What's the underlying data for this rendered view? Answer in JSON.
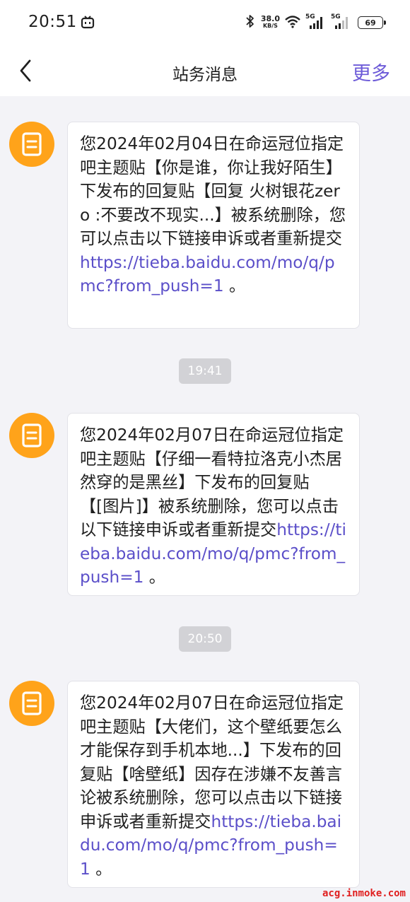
{
  "status_bar": {
    "time": "20:51",
    "net_speed_value": "38.0",
    "net_speed_unit": "KB/S",
    "sim1_label": "5G",
    "sim2_label": "5G",
    "battery": "69"
  },
  "nav": {
    "title": "站务消息",
    "more_label": "更多"
  },
  "messages": [
    {
      "text": "您2024年02月04日在命运冠位指定吧主题贴【你是谁，你让我好陌生】下发布的回复贴【回复 火树银花zero :不要改不现实...】被系统删除，您可以点击以下链接申诉或者重新提交",
      "link": "https://tieba.baidu.com/mo/q/pmc?from_push=1",
      "tail": " 。"
    },
    {
      "text": "您2024年02月07日在命运冠位指定吧主题贴【仔细一看特拉洛克小杰居然穿的是黑丝】下发布的回复贴【[图片]】被系统删除，您可以点击以下链接申诉或者重新提交",
      "link": "https://tieba.baidu.com/mo/q/pmc?from_push=1",
      "tail": " 。"
    },
    {
      "text": "您2024年02月07日在命运冠位指定吧主题贴【大佬们，这个壁纸要怎么才能保存到手机本地...】下发布的回复贴【啥壁纸】因存在涉嫌不友善言论被系统删除，您可以点击以下链接申诉或者重新提交",
      "link": "https://tieba.baidu.com/mo/q/pmc?from_push=1",
      "tail": " 。"
    }
  ],
  "timestamps": [
    "19:41",
    "20:50"
  ],
  "watermark": "acg.inmoke.com",
  "colors": {
    "accent": "#6d5bd8",
    "link": "#5b4fc9",
    "avatar_orange": "#ffa31a",
    "background": "#f3f3f7"
  },
  "icons": {
    "back": "chevron-left-icon",
    "avatar": "notice-document-icon"
  }
}
